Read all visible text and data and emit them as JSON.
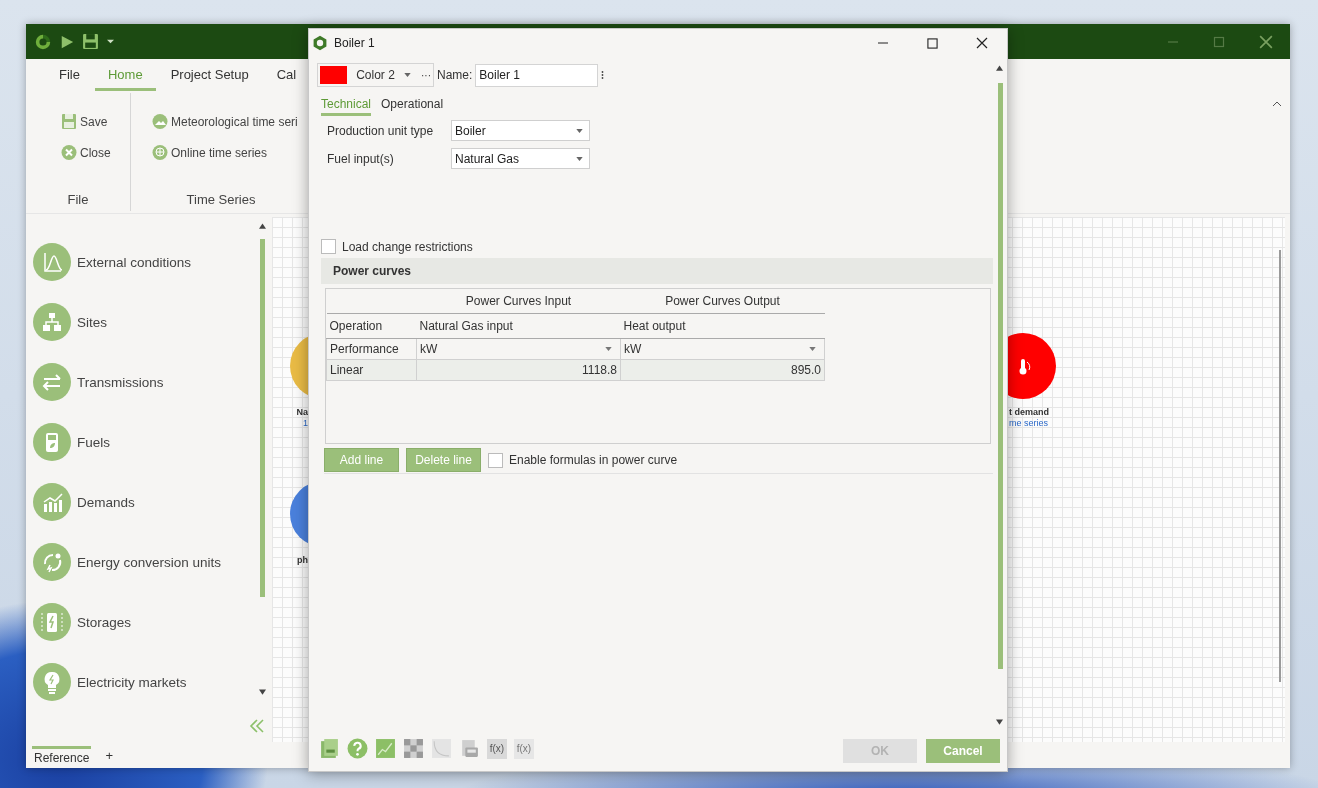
{
  "app": {
    "menu_tabs": [
      {
        "label": "File",
        "selected": false
      },
      {
        "label": "Home",
        "selected": true
      },
      {
        "label": "Project Setup",
        "selected": false
      },
      {
        "label": "Cal",
        "selected": false
      }
    ],
    "ribbon_groups": [
      {
        "title": "File",
        "buttons": [
          {
            "label": "Save"
          },
          {
            "label": "Close"
          }
        ]
      },
      {
        "title": "Time Series",
        "buttons": [
          {
            "label": "Meteorological time seri"
          },
          {
            "label": "Online time series"
          }
        ]
      }
    ],
    "sidebar": {
      "items": [
        {
          "label": "External conditions"
        },
        {
          "label": "Sites"
        },
        {
          "label": "Transmissions"
        },
        {
          "label": "Fuels"
        },
        {
          "label": "Demands"
        },
        {
          "label": "Energy conversion units"
        },
        {
          "label": "Storages"
        },
        {
          "label": "Electricity markets"
        }
      ]
    },
    "bottom_tabs": [
      {
        "label": "Reference",
        "selected": true
      }
    ],
    "add_tab": "+",
    "canvas": {
      "nodes": [
        {
          "color": "#e9bb45",
          "lines": [
            "Na",
            "1"
          ]
        },
        {
          "color": "#4a80dc",
          "lines": [
            "ph"
          ]
        },
        {
          "color": "#ff0000",
          "lines": [
            "t demand",
            "me series"
          ]
        }
      ]
    }
  },
  "dialog": {
    "title": "Boiler 1",
    "color_picker": {
      "label": "Color 2",
      "color": "#ff0000",
      "more": "···"
    },
    "name_label": "Name:",
    "name_value": "Boiler 1",
    "tabs": [
      {
        "label": "Technical",
        "selected": true
      },
      {
        "label": "Operational",
        "selected": false
      }
    ],
    "fields": [
      {
        "label": "Production unit type",
        "value": "Boiler"
      },
      {
        "label": "Fuel input(s)",
        "value": "Natural Gas"
      }
    ],
    "load_change": {
      "label": "Load change restrictions",
      "checked": false
    },
    "section_title": "Power curves",
    "table": {
      "groups": [
        "Power Curves Input",
        "Power Curves Output"
      ],
      "columns": [
        "Operation",
        "Natural Gas input",
        "Heat output"
      ],
      "rows": [
        {
          "kind": "unit",
          "cells": [
            "Performance",
            "kW",
            "kW"
          ]
        },
        {
          "kind": "value",
          "cells": [
            "Linear",
            "1118.8",
            "895.0"
          ]
        }
      ]
    },
    "line_buttons": [
      "Add line",
      "Delete line"
    ],
    "formulas": {
      "label": "Enable formulas in power curve",
      "checked": false
    },
    "tools": [
      {
        "kind": "doc"
      },
      {
        "kind": "help"
      },
      {
        "kind": "chart"
      },
      {
        "kind": "checker"
      },
      {
        "kind": "curve"
      },
      {
        "kind": "printer"
      },
      {
        "kind": "formula",
        "label": "f(x)"
      },
      {
        "kind": "formula-off",
        "label": "f(x)"
      }
    ],
    "buttons": [
      {
        "label": "OK",
        "disabled": true
      },
      {
        "label": "Cancel",
        "disabled": false
      }
    ]
  }
}
